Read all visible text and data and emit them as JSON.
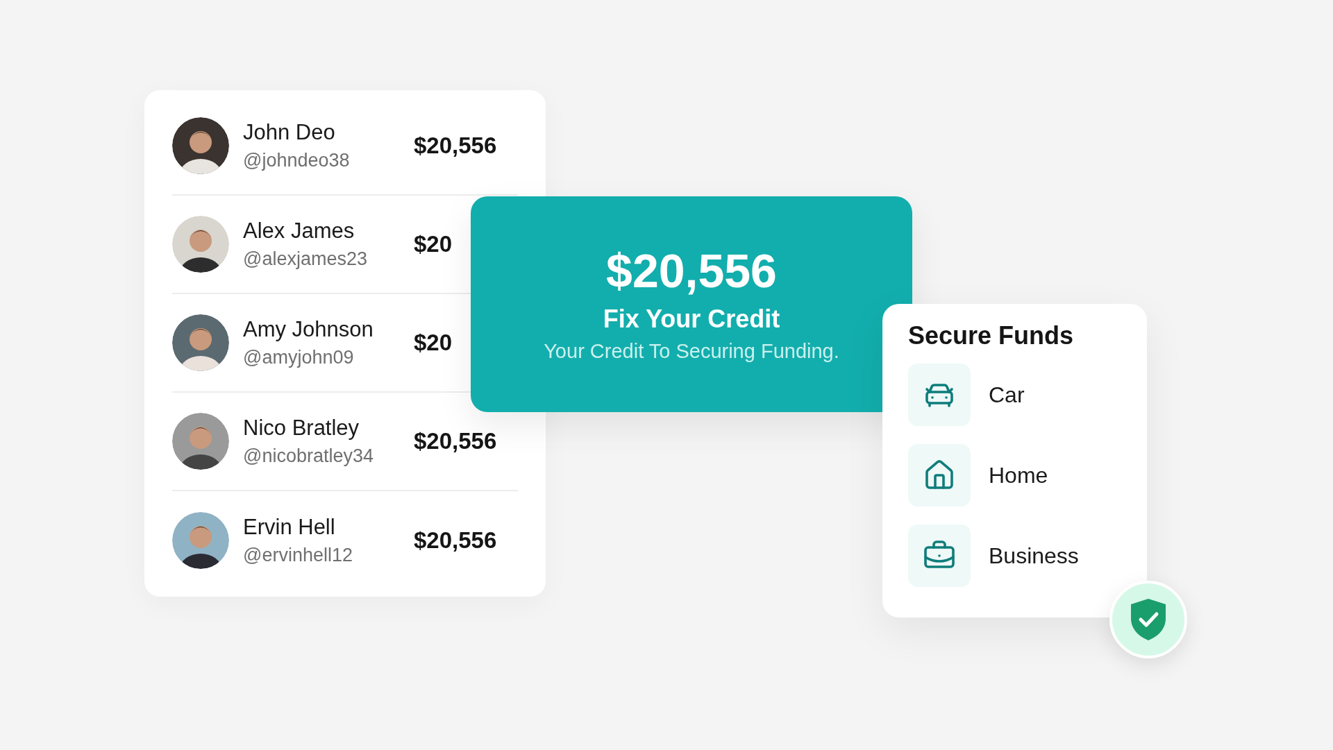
{
  "people": [
    {
      "name": "John Deo",
      "handle": "@johndeo38",
      "amount": "$20,556"
    },
    {
      "name": "Alex James",
      "handle": "@alexjames23",
      "amount": "$20"
    },
    {
      "name": "Amy Johnson",
      "handle": "@amyjohn09",
      "amount": "$20"
    },
    {
      "name": "Nico Bratley",
      "handle": "@nicobratley34",
      "amount": "$20,556"
    },
    {
      "name": "Ervin Hell",
      "handle": "@ervinhell12",
      "amount": "$20,556"
    }
  ],
  "credit_card": {
    "amount": "$20,556",
    "title": "Fix Your Credit",
    "subtitle": "Your Credit To Securing Funding."
  },
  "funds": {
    "title": "Secure Funds",
    "items": [
      {
        "label": "Car",
        "kind": "car"
      },
      {
        "label": "Home",
        "kind": "home"
      },
      {
        "label": "Business",
        "kind": "business"
      }
    ]
  }
}
